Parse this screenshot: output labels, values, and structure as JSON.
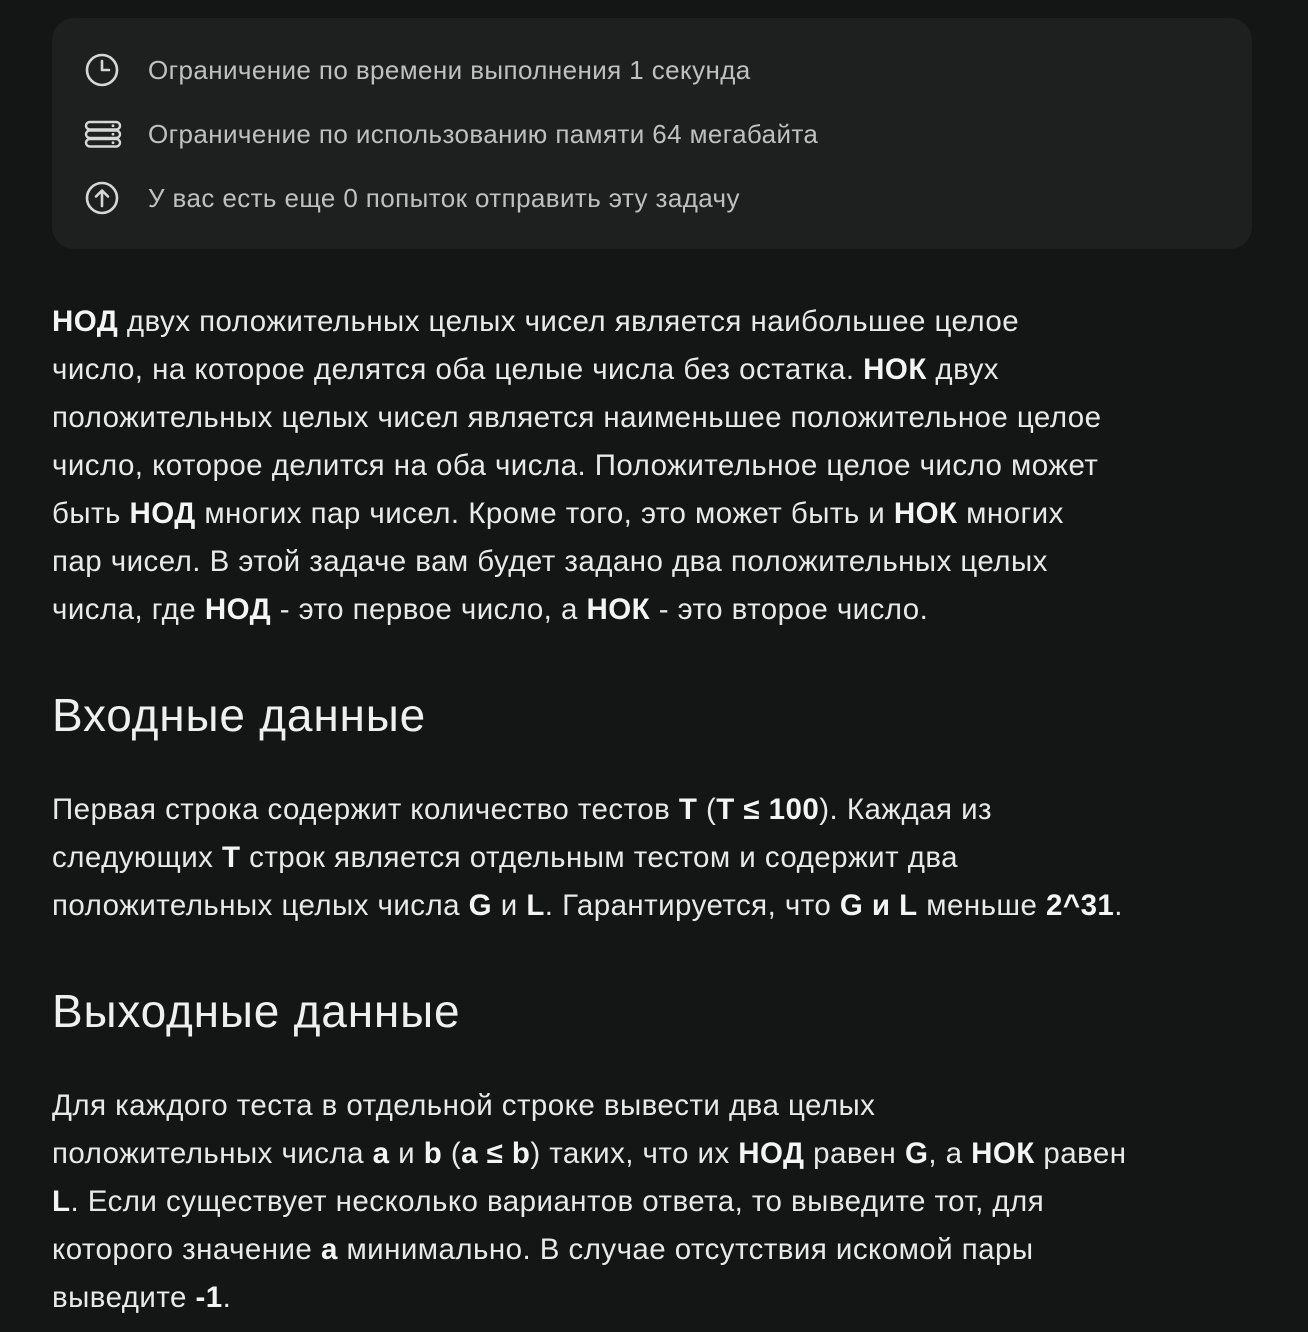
{
  "limits": {
    "time": {
      "icon": "clock-icon",
      "text": "Ограничение по времени выполнения 1 секунда"
    },
    "memory": {
      "icon": "memory-icon",
      "text": "Ограничение по использованию памяти 64 мегабайта"
    },
    "attempts": {
      "icon": "upload-arrow-icon",
      "text": "У вас есть еще 0 попыток отправить эту задачу"
    }
  },
  "statement": {
    "line1": {
      "a": "НОД",
      "b": " двух положительных целых чисел является наибольшее целое"
    },
    "line2": {
      "a": "число, на которое делятся оба целые числа без остатка. ",
      "b": "НОК",
      "c": " двух"
    },
    "line3": "положительных целых чисел является наименьшее положительное целое",
    "line4": "число, которое делится на оба числа. Положительное целое число может",
    "line5": {
      "a": "быть ",
      "b": "НОД",
      "c": " многих пар чисел. Кроме того, это может быть и ",
      "d": "НОК",
      "e": " многих"
    },
    "line6": "пар чисел. В этой задаче вам будет задано два положительных целых",
    "line7": {
      "a": "числа, где ",
      "b": "НОД",
      "c": " - это первое число, а ",
      "d": "НОК",
      "e": " - это второе число."
    }
  },
  "input_section": {
    "heading": "Входные данные",
    "line1": {
      "a": "Первая строка содержит количество тестов ",
      "b": "T",
      "c": " (",
      "d": "T ≤ 100",
      "e": "). Каждая из"
    },
    "line2": {
      "a": "следующих ",
      "b": "T",
      "c": " строк является отдельным тестом и содержит два"
    },
    "line3": {
      "a": "положительных целых числа ",
      "b": "G",
      "c": " и ",
      "d": "L",
      "e": ". Гарантируется, что ",
      "f": "G",
      "g": " и ",
      "h": "L",
      "i": " меньше ",
      "j": "2^31",
      "k": "."
    }
  },
  "output_section": {
    "heading": "Выходные данные",
    "line1": "Для каждого теста в отдельной строке вывести два целых",
    "line2": {
      "a": "положительных числа ",
      "b": "a",
      "c": " и ",
      "d": "b",
      "e": " (",
      "f": "a ≤ b",
      "g": ") таких, что их ",
      "h": "НОД",
      "i": " равен ",
      "j": "G",
      "k": ", а ",
      "l": "НОК",
      "m": " равен"
    },
    "line3": {
      "a": "L",
      "b": ". Если существует несколько вариантов ответа, то выведите тот, для"
    },
    "line4": {
      "a": "которого значение ",
      "b": "a",
      "c": " минимально. В случае отсутствия искомой пары"
    },
    "line5": {
      "a": "выведите ",
      "b": "-1",
      "c": "."
    }
  }
}
